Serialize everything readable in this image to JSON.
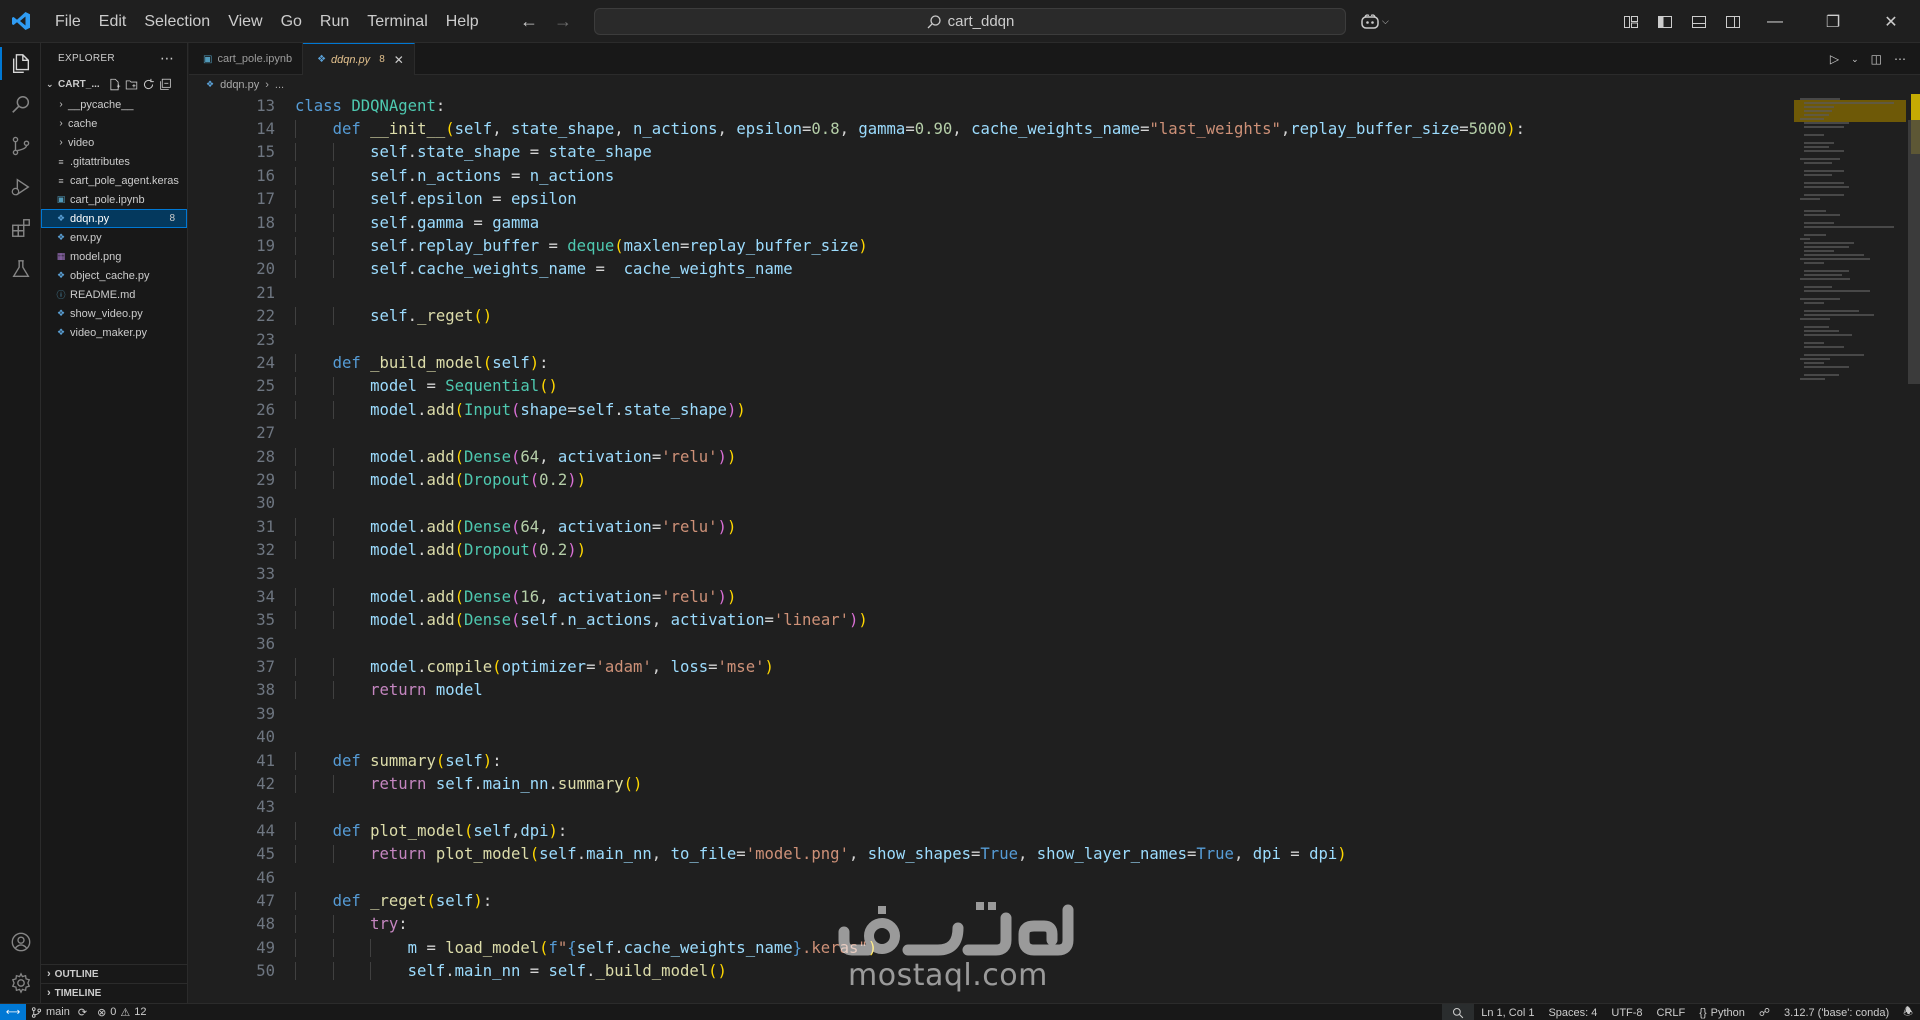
{
  "menu": [
    "File",
    "Edit",
    "Selection",
    "View",
    "Go",
    "Run",
    "Terminal",
    "Help"
  ],
  "search": {
    "text": "cart_ddqn"
  },
  "explorer": {
    "title": "EXPLORER",
    "folder": "CART_...",
    "items": [
      {
        "label": "__pycache__",
        "type": "folder"
      },
      {
        "label": "cache",
        "type": "folder"
      },
      {
        "label": "video",
        "type": "folder"
      },
      {
        "label": ".gitattributes",
        "type": "file",
        "icon": "lines-icon"
      },
      {
        "label": "cart_pole_agent.keras",
        "type": "file",
        "icon": "lines-icon"
      },
      {
        "label": "cart_pole.ipynb",
        "type": "file",
        "icon": "notebook-icon"
      },
      {
        "label": "ddqn.py",
        "type": "file",
        "icon": "python-icon",
        "badge": "8",
        "selected": true
      },
      {
        "label": "env.py",
        "type": "file",
        "icon": "python-icon"
      },
      {
        "label": "model.png",
        "type": "file",
        "icon": "image-icon"
      },
      {
        "label": "object_cache.py",
        "type": "file",
        "icon": "python-icon"
      },
      {
        "label": "README.md",
        "type": "file",
        "icon": "info-icon"
      },
      {
        "label": "show_video.py",
        "type": "file",
        "icon": "python-icon"
      },
      {
        "label": "video_maker.py",
        "type": "file",
        "icon": "python-icon"
      }
    ],
    "outline": "OUTLINE",
    "timeline": "TIMELINE"
  },
  "tabs": [
    {
      "label": "cart_pole.ipynb",
      "active": false
    },
    {
      "label": "ddqn.py",
      "modified": "8",
      "active": true
    }
  ],
  "breadcrumb": {
    "file": "ddqn.py",
    "rest": "..."
  },
  "code": [
    {
      "n": "13"
    },
    {
      "n": "14"
    },
    {
      "n": "15"
    },
    {
      "n": "16"
    },
    {
      "n": "17"
    },
    {
      "n": "18"
    },
    {
      "n": "19"
    },
    {
      "n": "20"
    },
    {
      "n": "21"
    },
    {
      "n": "22"
    },
    {
      "n": "23"
    },
    {
      "n": "24"
    },
    {
      "n": "25"
    },
    {
      "n": "26"
    },
    {
      "n": "27"
    },
    {
      "n": "28"
    },
    {
      "n": "29"
    },
    {
      "n": "30"
    },
    {
      "n": "31"
    },
    {
      "n": "32"
    },
    {
      "n": "33"
    },
    {
      "n": "34"
    },
    {
      "n": "35"
    },
    {
      "n": "36"
    },
    {
      "n": "37"
    },
    {
      "n": "38"
    },
    {
      "n": "39"
    },
    {
      "n": "40"
    },
    {
      "n": "41"
    },
    {
      "n": "42"
    },
    {
      "n": "43"
    },
    {
      "n": "44"
    },
    {
      "n": "45"
    },
    {
      "n": "46"
    },
    {
      "n": "47"
    },
    {
      "n": "48"
    },
    {
      "n": "49"
    },
    {
      "n": "50"
    }
  ],
  "watermark": {
    "latin": "mostaql.com"
  },
  "status": {
    "branch": "main",
    "errors": "0",
    "warnings": "12",
    "position": "Ln 1, Col 1",
    "spaces": "Spaces: 4",
    "encoding": "UTF-8",
    "eol": "CRLF",
    "language": "Python",
    "interpreter": "3.12.7 ('base': conda)"
  },
  "colors": {
    "accent": "#0078d4",
    "editor_bg": "#1f1f1f",
    "keyword": "#569cd6",
    "class_name": "#4ec9b0",
    "function": "#dcdcaa",
    "string": "#ce9178",
    "number": "#b5cea8",
    "variable": "#9cdcfe"
  }
}
